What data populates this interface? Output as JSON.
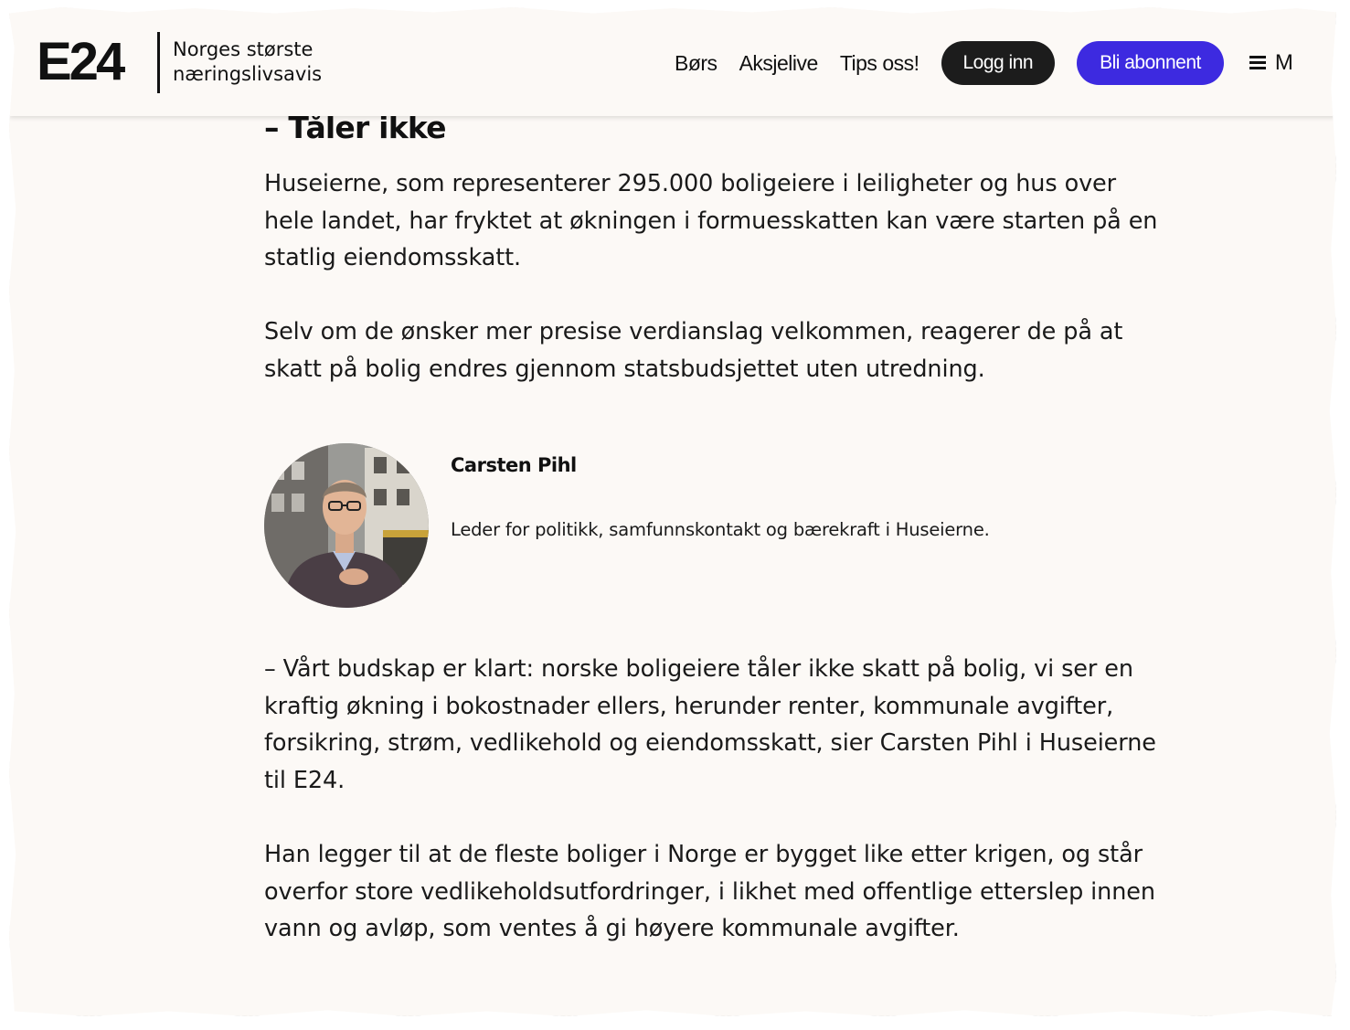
{
  "header": {
    "logo": "E24",
    "tagline": "Norges største næringslivsavis",
    "nav": [
      "Børs",
      "Aksjelive",
      "Tips oss!"
    ],
    "login_label": "Logg inn",
    "subscribe_label": "Bli abonnent",
    "menu_label": "M",
    "colors": {
      "login_bg": "#1c1c1c",
      "subscribe_bg": "#3d2ae0"
    }
  },
  "article": {
    "heading": "– Tåler ikke",
    "paragraphs": [
      "Huseierne, som representerer 295.000 boligeiere i leiligheter og hus over hele landet, har fryktet at økningen i formuesskatten kan være starten på en statlig eiendomsskatt.",
      "Selv om de ønsker mer presise verdianslag velkommen, reagerer de på at skatt på bolig endres gjennom statsbudsjettet uten utredning.",
      "– Vårt budskap er klart: norske boligeiere tåler ikke skatt på bolig, vi ser en kraftig økning i bokostnader ellers, herunder renter, kommunale avgifter, forsikring, strøm, vedlikehold og eiendomsskatt, sier Carsten Pihl i Huseierne til E24.",
      "Han legger til at de fleste boliger i Norge er bygget like etter krigen, og står overfor store vedlikeholdsutfordringer, i likhet med offentlige etterslep innen vann og avløp, som ventes å gi høyere kommunale avgifter."
    ],
    "person": {
      "name": "Carsten Pihl",
      "role": "Leder for politikk, samfunnskontakt og bærekraft i Huseierne."
    }
  }
}
